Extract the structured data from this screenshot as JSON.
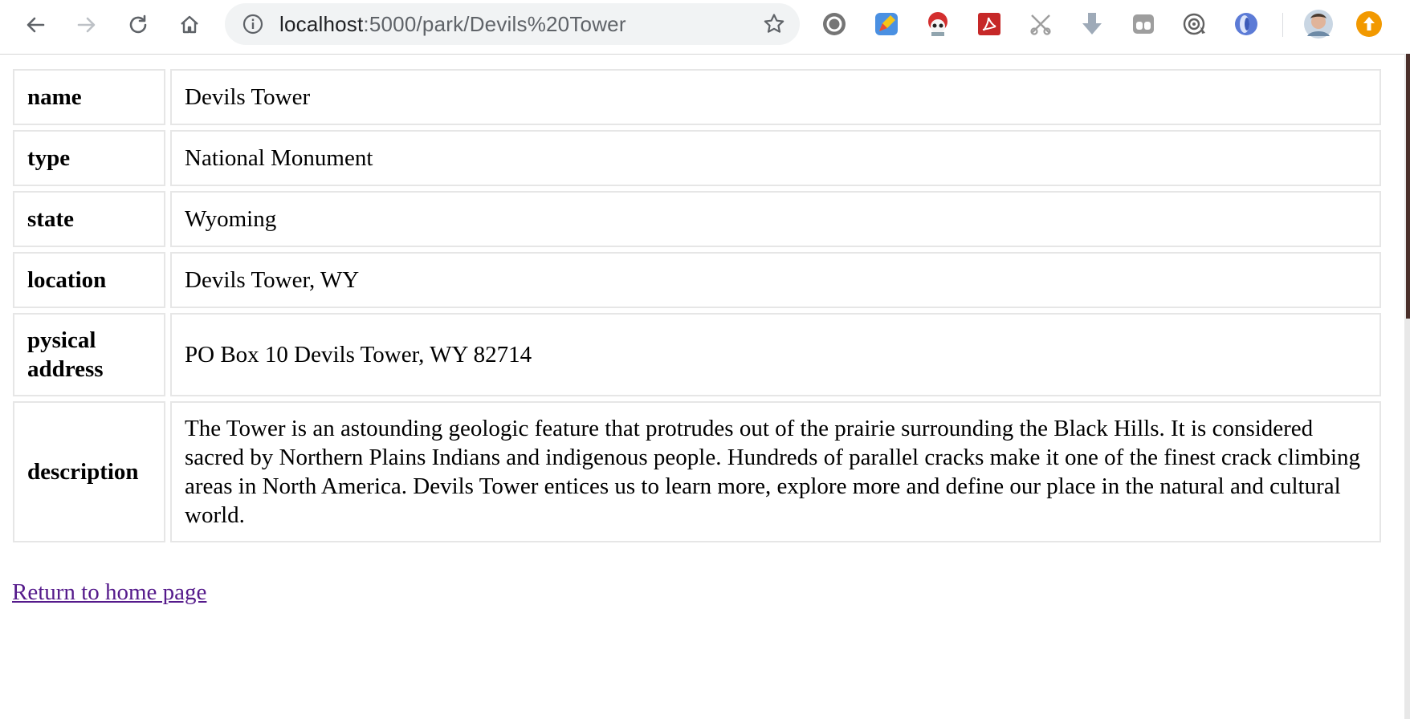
{
  "browser": {
    "url_host": "localhost",
    "url_path": ":5000/park/Devils%20Tower",
    "nav": [
      "back-icon",
      "forward-icon",
      "reload-icon",
      "home-icon"
    ],
    "extensions": [
      "record-icon",
      "pencil-extension-icon",
      "mascot-extension-icon",
      "pdf-extension-icon",
      "scissors-icon",
      "download-icon",
      "window-extension-icon",
      "target-extension-icon",
      "swirl-extension-icon"
    ],
    "colors": {
      "omnibox_bg": "#f1f3f4",
      "update_badge": "#f29900"
    }
  },
  "park": {
    "rows": [
      {
        "key": "name",
        "value": "Devils Tower"
      },
      {
        "key": "type",
        "value": "National Monument"
      },
      {
        "key": "state",
        "value": "Wyoming"
      },
      {
        "key": "location",
        "value": "Devils Tower, WY"
      },
      {
        "key": "pysical address",
        "value": "PO Box 10 Devils Tower, WY 82714"
      },
      {
        "key": "description",
        "value": "The Tower is an astounding geologic feature that protrudes out of the prairie surrounding the Black Hills. It is considered sacred by Northern Plains Indians and indigenous people. Hundreds of parallel cracks make it one of the finest crack climbing areas in North America. Devils Tower entices us to learn more, explore more and define our place in the natural and cultural world."
      }
    ]
  },
  "links": {
    "return_home": "Return to home page",
    "visited_color": "#551a8b"
  }
}
